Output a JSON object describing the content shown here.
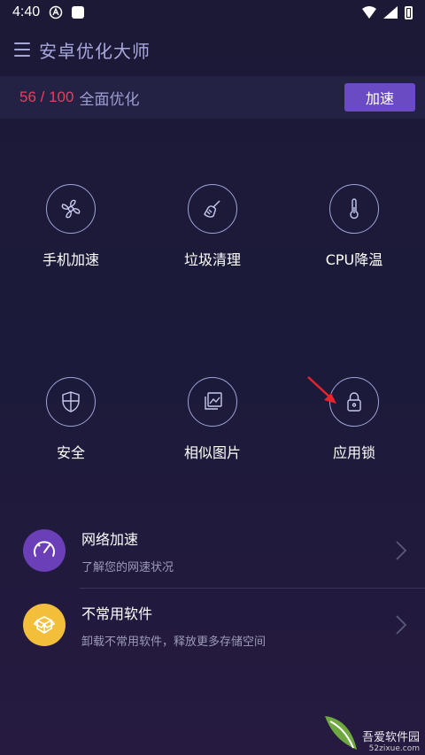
{
  "status_bar": {
    "time": "4:40"
  },
  "app_bar": {
    "title": "安卓优化大师"
  },
  "score_bar": {
    "score": "56 / 100",
    "label": "全面优化",
    "button_label": "加速"
  },
  "grid": [
    {
      "label": "手机加速",
      "icon": "fan-icon"
    },
    {
      "label": "垃圾清理",
      "icon": "broom-icon"
    },
    {
      "label": "CPU降温",
      "icon": "thermometer-icon"
    },
    {
      "label": "安全",
      "icon": "shield-icon"
    },
    {
      "label": "相似图片",
      "icon": "gallery-icon"
    },
    {
      "label": "应用锁",
      "icon": "lock-icon"
    }
  ],
  "list": [
    {
      "title": "网络加速",
      "subtitle": "了解您的网速状况",
      "icon": "speedometer-icon",
      "color": "#6b3fb8"
    },
    {
      "title": "不常用软件",
      "subtitle": "卸载不常用软件，释放更多存储空间",
      "icon": "box-icon",
      "color": "#f3be3a"
    }
  ],
  "watermark": {
    "text": "吾爱软件园",
    "url": "52zixue.com"
  },
  "colors": {
    "accent": "#6a4bc3",
    "score": "#e4405f",
    "title": "#a9a8dc"
  }
}
